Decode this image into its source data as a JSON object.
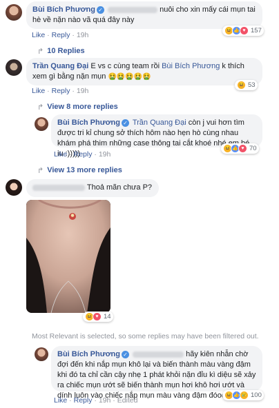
{
  "comments": [
    {
      "author": "Bùi Bích Phương",
      "text": "nuôi cho xin mấy cái mụn tai hè về nặn nào vã quá đây này",
      "actions": {
        "like": "Like",
        "reply": "Reply",
        "time": "19h"
      },
      "reaction_count": "157",
      "replies_link": "10 Replies"
    },
    {
      "author": "Trần Quang Đại",
      "text_before": "E vs c cùng team rồi ",
      "mention": "Bùi Bích Phương",
      "text_after": " k thích xem gì bằng nặn mụn",
      "emoji": "🤮🤮🤮🤮🤮",
      "actions": {
        "like": "Like",
        "reply": "Reply",
        "time": "19h"
      },
      "reaction_count": "53",
      "more_replies": "View 8 more replies"
    },
    {
      "author": "Bùi Bích Phương",
      "mention": "Trần Quang Đại",
      "text": " còn j vui hơn tìm được tri kỉ chung sở thích hôm nào hẹn hò cùng nhau khám phá thim những case thông tai cắt khoé nhé em bé iu :)))))",
      "actions": {
        "like": "Like",
        "reply": "Reply",
        "time": "19h"
      },
      "reaction_count": "70",
      "more_replies": "View 13 more replies"
    },
    {
      "text": "Thoả mãn chưa P?",
      "reaction_count": "14"
    }
  ],
  "filter_notice": "Most Relevant is selected, so some replies may have been filtered out.",
  "last_reply": {
    "author": "Bùi Bích Phương",
    "text": "hãy kiên nhẫn chờ đợi đến khi nắp mụn khô lại và biến thành màu vàng đậm khi đó ta chỉ cần cậy nhẹ 1 phát khỏi nặn đỉu kì diệu sẽ xảy ra chiếc mụn ướt sẽ biến thành mụn hơi khô hơi ướt và dính luôn vào chiếc nắp mụn màu vàng đậm đóooo",
    "actions": {
      "like": "Like",
      "reply": "Reply",
      "time": "19h",
      "edited": "Edited"
    },
    "reaction_count": "100"
  },
  "icons": {
    "verified": "verified-badge-icon",
    "reply_arrow": "reply-arrow-icon",
    "reactions": [
      "haha-reaction-icon",
      "like-reaction-icon",
      "love-reaction-icon",
      "sad-reaction-icon"
    ]
  },
  "colors": {
    "link": "#385898",
    "bubble": "#f2f3f5",
    "meta": "#90949c",
    "verified": "#4a90e2"
  }
}
